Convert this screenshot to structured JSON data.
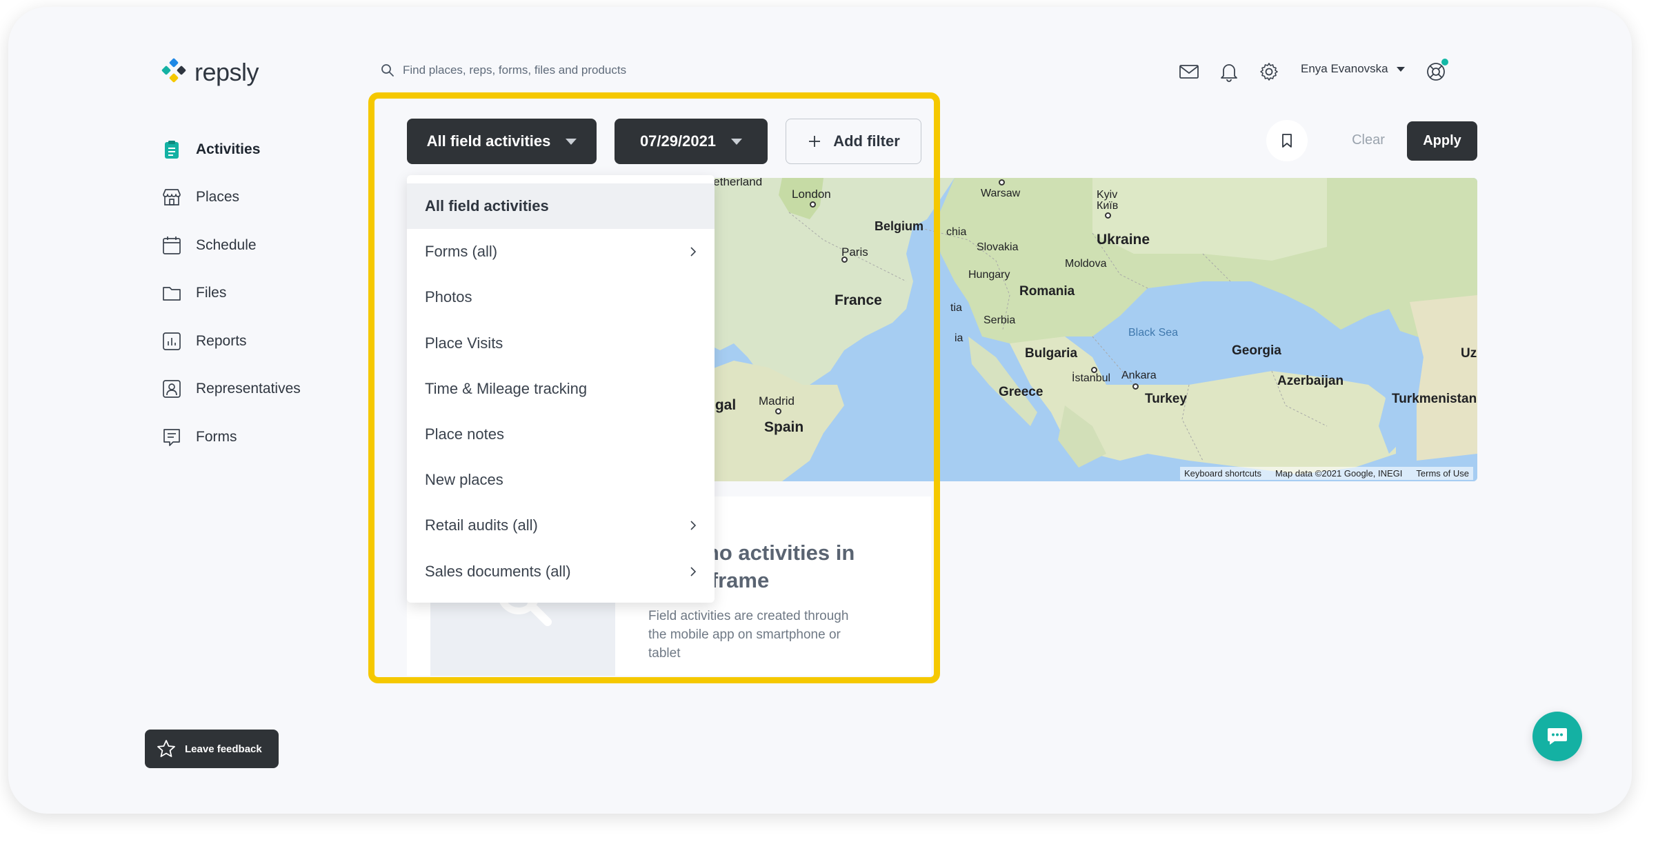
{
  "app": {
    "name": "repsly"
  },
  "search": {
    "placeholder": "Find places, reps, forms, files and products"
  },
  "header": {
    "user_name": "Enya Evanovska"
  },
  "sidebar": {
    "items": [
      {
        "label": "Activities",
        "icon": "clipboard-icon",
        "active": true
      },
      {
        "label": "Places",
        "icon": "store-icon"
      },
      {
        "label": "Schedule",
        "icon": "calendar-icon"
      },
      {
        "label": "Files",
        "icon": "folder-icon"
      },
      {
        "label": "Reports",
        "icon": "chart-icon"
      },
      {
        "label": "Representatives",
        "icon": "person-card-icon"
      },
      {
        "label": "Forms",
        "icon": "form-icon"
      }
    ]
  },
  "filters": {
    "activity_type": "All field activities",
    "date": "07/29/2021",
    "add_filter_label": "Add filter",
    "clear_label": "Clear",
    "apply_label": "Apply"
  },
  "dropdown": {
    "items": [
      {
        "label": "All field activities",
        "selected": true,
        "has_submenu": false
      },
      {
        "label": "Forms (all)",
        "has_submenu": true
      },
      {
        "label": "Photos",
        "has_submenu": false
      },
      {
        "label": "Place Visits",
        "has_submenu": false
      },
      {
        "label": "Time & Mileage tracking",
        "has_submenu": false
      },
      {
        "label": "Place notes",
        "has_submenu": false
      },
      {
        "label": "New places",
        "has_submenu": false
      },
      {
        "label": "Retail audits (all)",
        "has_submenu": true
      },
      {
        "label": "Sales documents (all)",
        "has_submenu": true
      }
    ]
  },
  "map": {
    "labels": {
      "london": "London",
      "belgium": "Belgium",
      "paris": "Paris",
      "france": "France",
      "madrid": "Madrid",
      "spain": "Spain",
      "portugal_partial": "ugal",
      "netherlands_partial": "Netherland",
      "warsaw": "Warsaw",
      "kyiv": "Kyiv",
      "kyiv_local": "Київ",
      "ukraine": "Ukraine",
      "slovakia": "Slovakia",
      "czechia_partial": "chia",
      "moldova": "Moldova",
      "hungary": "Hungary",
      "romania": "Romania",
      "serbia": "Serbia",
      "bosnia_partial": "ia",
      "croatia_partial": "tia",
      "bulgaria": "Bulgaria",
      "black_sea": "Black Sea",
      "georgia": "Georgia",
      "uzbekistan_partial": "Uzb",
      "istanbul": "İstanbul",
      "ankara": "Ankara",
      "greece": "Greece",
      "turkey": "Turkey",
      "azerbaijan": "Azerbaijan",
      "turkmenistan": "Turkmenistan"
    },
    "footer": {
      "shortcuts": "Keyboard shortcuts",
      "attribution": "Map data ©2021 Google, INEGI",
      "terms": "Terms of Use"
    }
  },
  "empty_state": {
    "title": "re no activities in\nne frame",
    "subtitle": "Field activities are created through the mobile app on smartphone or tablet"
  },
  "feedback": {
    "label": "Leave feedback"
  },
  "colors": {
    "accent": "#14b1a3",
    "highlight": "#f5c800",
    "dark_button": "#2f3337"
  }
}
